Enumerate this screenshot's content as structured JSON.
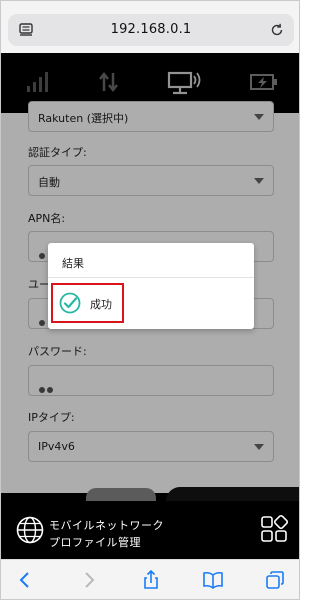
{
  "browser": {
    "url": "192.168.0.1"
  },
  "status_icons": [
    "signal-icon",
    "data-transfer-icon",
    "connected-screen-icon",
    "battery-charging-icon"
  ],
  "form": {
    "profile_select_value": "Rakuten (選択中)",
    "auth_label": "認証タイプ:",
    "auth_value": "自動",
    "apn_label": "APN名:",
    "user_label": "ユー",
    "password_label": "パスワード:",
    "ip_label": "IPタイプ:",
    "ip_value": "IPv4v6"
  },
  "modal": {
    "title": "結果",
    "message": "成功"
  },
  "bottom_nav": {
    "label_line1": "モバイルネットワーク",
    "label_line2": "プロファイル管理"
  },
  "colors": {
    "highlight_red": "#d9141b",
    "success_teal": "#27b7a4"
  }
}
